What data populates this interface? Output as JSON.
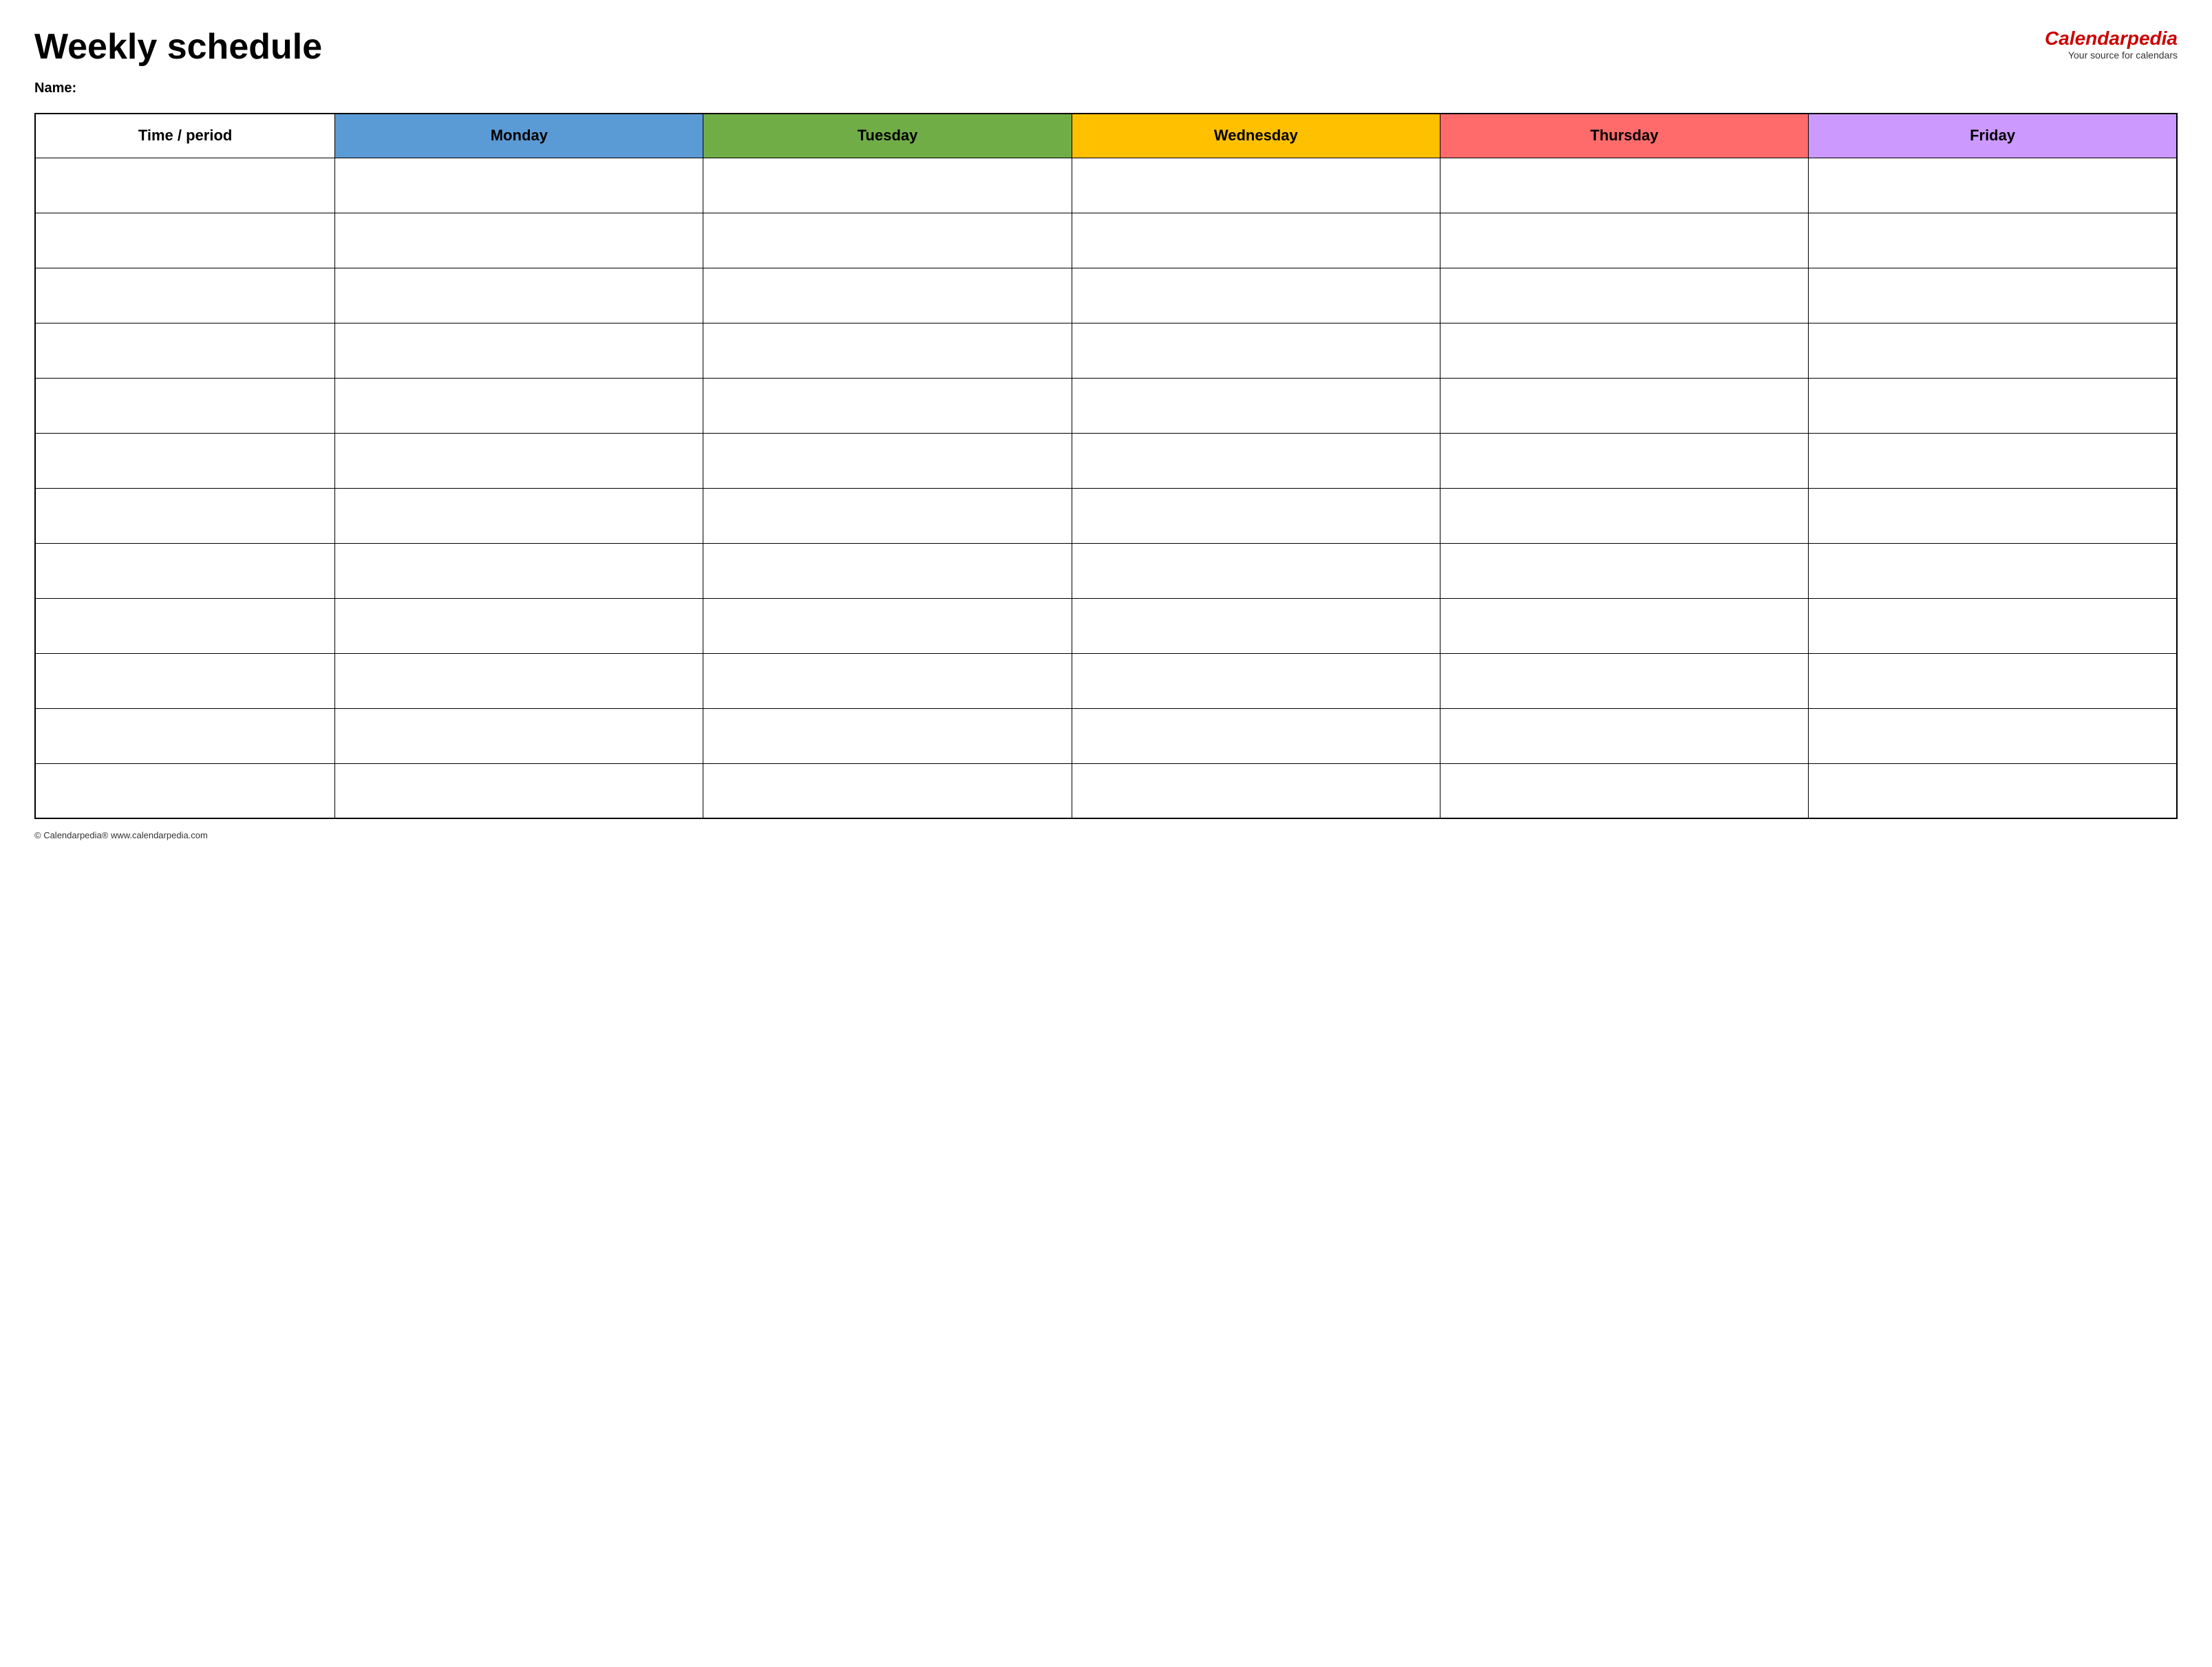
{
  "header": {
    "title": "Weekly schedule",
    "logo": {
      "prefix": "Calendar",
      "suffix": "pedia",
      "tagline": "Your source for calendars"
    }
  },
  "name_label": "Name:",
  "table": {
    "columns": [
      {
        "key": "time",
        "label": "Time / period",
        "color": "#ffffff",
        "class": "col-time"
      },
      {
        "key": "monday",
        "label": "Monday",
        "color": "#5b9bd5",
        "class": "col-monday"
      },
      {
        "key": "tuesday",
        "label": "Tuesday",
        "color": "#70ad47",
        "class": "col-tuesday"
      },
      {
        "key": "wednesday",
        "label": "Wednesday",
        "color": "#ffc000",
        "class": "col-wednesday"
      },
      {
        "key": "thursday",
        "label": "Thursday",
        "color": "#ff6b6b",
        "class": "col-thursday"
      },
      {
        "key": "friday",
        "label": "Friday",
        "color": "#cc99ff",
        "class": "col-friday"
      }
    ],
    "row_count": 12
  },
  "footer": {
    "text": "© Calendarpedia®  www.calendarpedia.com"
  }
}
